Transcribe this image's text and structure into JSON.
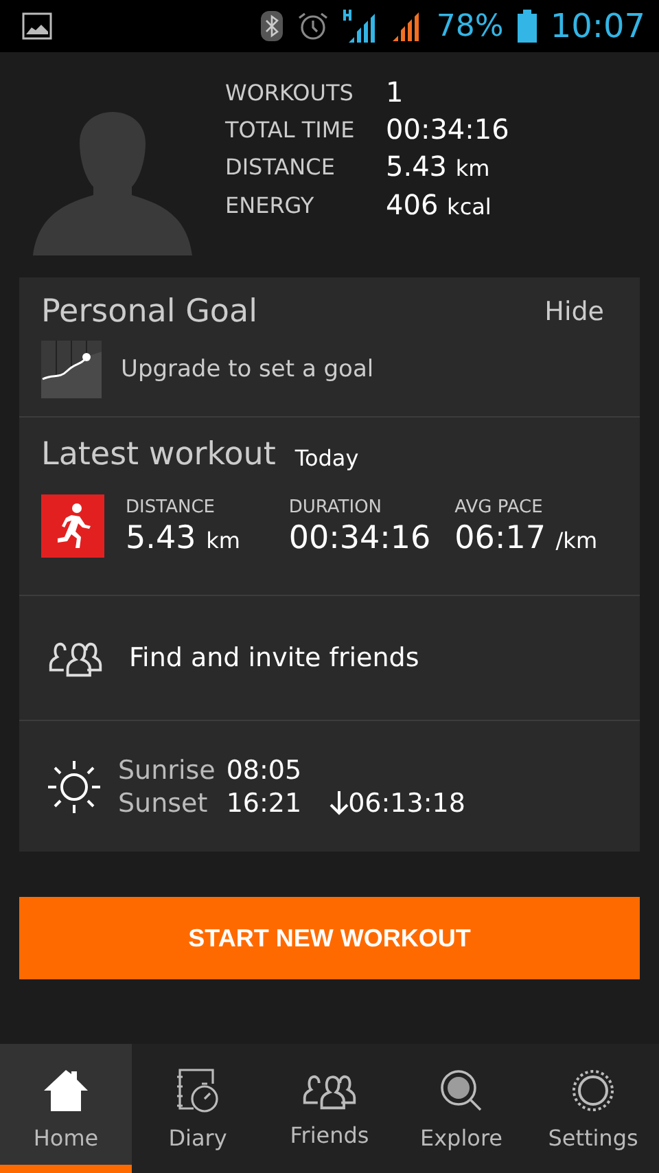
{
  "status_bar": {
    "battery": "78%",
    "time": "10:07"
  },
  "summary": {
    "stats": [
      {
        "label": "WORKOUTS",
        "value": "1"
      },
      {
        "label": "TOTAL TIME",
        "value": "00:34:16"
      },
      {
        "label": "DISTANCE",
        "value": "5.43",
        "unit": "km"
      },
      {
        "label": "ENERGY",
        "value": "406",
        "unit": "kcal"
      }
    ]
  },
  "personal_goal": {
    "title": "Personal Goal",
    "action": "Hide",
    "message": "Upgrade to set a goal"
  },
  "latest_workout": {
    "title": "Latest workout",
    "date": "Today",
    "metrics": [
      {
        "label": "DISTANCE",
        "value": "5.43",
        "unit": "km"
      },
      {
        "label": "DURATION",
        "value": "00:34:16"
      },
      {
        "label": "AVG PACE",
        "value": "06:17",
        "unit": "/km"
      }
    ]
  },
  "friends": {
    "label": "Find and invite friends"
  },
  "sun": {
    "sunrise_label": "Sunrise",
    "sunrise": "08:05",
    "sunset_label": "Sunset",
    "sunset": "16:21",
    "daylight": "06:13:18"
  },
  "start_button": "START NEW WORKOUT",
  "nav": [
    {
      "label": "Home",
      "selected": true
    },
    {
      "label": "Diary",
      "selected": false
    },
    {
      "label": "Friends",
      "selected": false
    },
    {
      "label": "Explore",
      "selected": false
    },
    {
      "label": "Settings",
      "selected": false
    }
  ]
}
